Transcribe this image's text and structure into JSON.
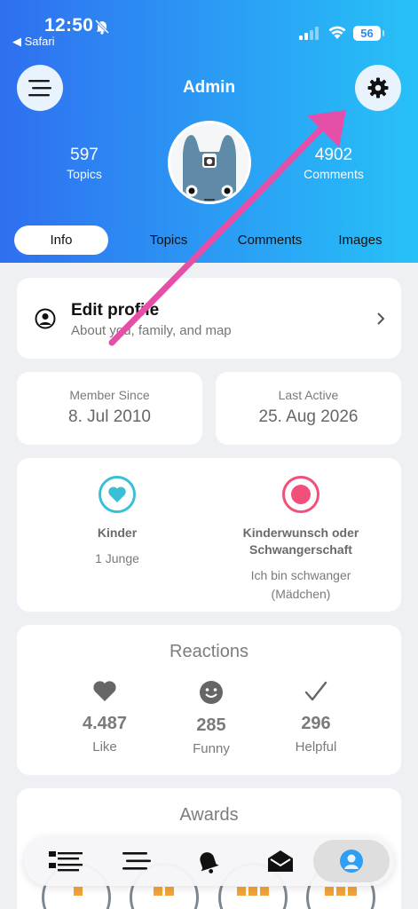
{
  "status_bar": {
    "time": "12:50",
    "back_app": "◀ Safari",
    "battery": "56"
  },
  "header": {
    "title": "Admin"
  },
  "stats": {
    "topics": {
      "value": "597",
      "label": "Topics"
    },
    "comments": {
      "value": "4902",
      "label": "Comments"
    }
  },
  "tabs": [
    {
      "label": "Info",
      "active": true
    },
    {
      "label": "Topics",
      "active": false
    },
    {
      "label": "Comments",
      "active": false
    },
    {
      "label": "Images",
      "active": false
    }
  ],
  "edit_profile": {
    "title": "Edit profile",
    "subtitle": "About you, family, and map"
  },
  "member_since": {
    "label": "Member Since",
    "value": "8. Jul 2010"
  },
  "last_active": {
    "label": "Last Active",
    "value": "25. Aug 2026"
  },
  "details": {
    "kinder": {
      "title": "Kinder",
      "value": "1 Junge"
    },
    "wish": {
      "title_line1": "Kinderwunsch oder",
      "title_line2": "Schwangerschaft",
      "value_line1": "Ich bin schwanger",
      "value_line2": "(Mädchen)"
    }
  },
  "reactions": {
    "heading": "Reactions",
    "items": [
      {
        "value": "4.487",
        "label": "Like",
        "icon": "heart-icon"
      },
      {
        "value": "285",
        "label": "Funny",
        "icon": "smiley-icon"
      },
      {
        "value": "296",
        "label": "Helpful",
        "icon": "checkmark-icon"
      }
    ]
  },
  "awards": {
    "heading": "Awards"
  },
  "bottom_nav": [
    "list-icon",
    "menu-icon",
    "bell-icon",
    "mail-icon",
    "profile-icon"
  ],
  "colors": {
    "header_start": "#2f6ff0",
    "header_end": "#27c1f7",
    "kinder_accent": "#3bbfd6",
    "wish_accent": "#f0507a",
    "annotation_arrow": "#e54fa8"
  }
}
